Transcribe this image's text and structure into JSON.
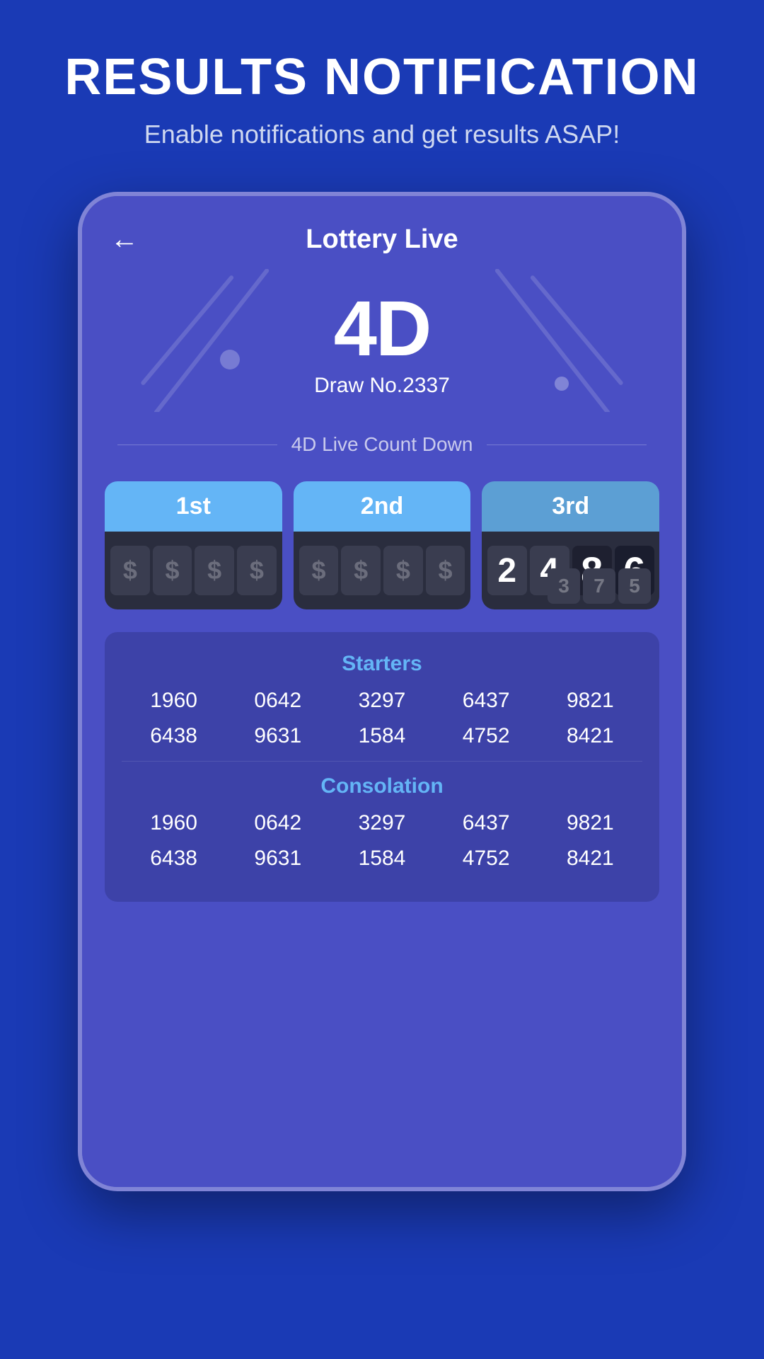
{
  "header": {
    "title": "RESULTS NOTIFICATION",
    "subtitle": "Enable notifications and get results ASAP!"
  },
  "app": {
    "title": "Lottery Live",
    "back_label": "←",
    "logo": "4D",
    "draw_no": "Draw No.2337",
    "countdown_label": "4D Live Count Down"
  },
  "prizes": [
    {
      "label": "1st",
      "type": "empty",
      "slots": [
        "$",
        "$",
        "$",
        "$"
      ]
    },
    {
      "label": "2nd",
      "type": "empty",
      "slots": [
        "$",
        "$",
        "$",
        "$"
      ]
    },
    {
      "label": "3rd",
      "type": "numbers",
      "slots": [
        "2",
        "4",
        "8",
        "6"
      ],
      "fading": [
        "3",
        "7",
        "5"
      ]
    }
  ],
  "starters": {
    "label": "Starters",
    "rows": [
      [
        "1960",
        "0642",
        "3297",
        "6437",
        "9821"
      ],
      [
        "6438",
        "9631",
        "1584",
        "4752",
        "8421"
      ]
    ]
  },
  "consolation": {
    "label": "Consolation",
    "rows": [
      [
        "1960",
        "0642",
        "3297",
        "6437",
        "9821"
      ],
      [
        "6438",
        "9631",
        "1584",
        "4752",
        "8421"
      ]
    ]
  }
}
